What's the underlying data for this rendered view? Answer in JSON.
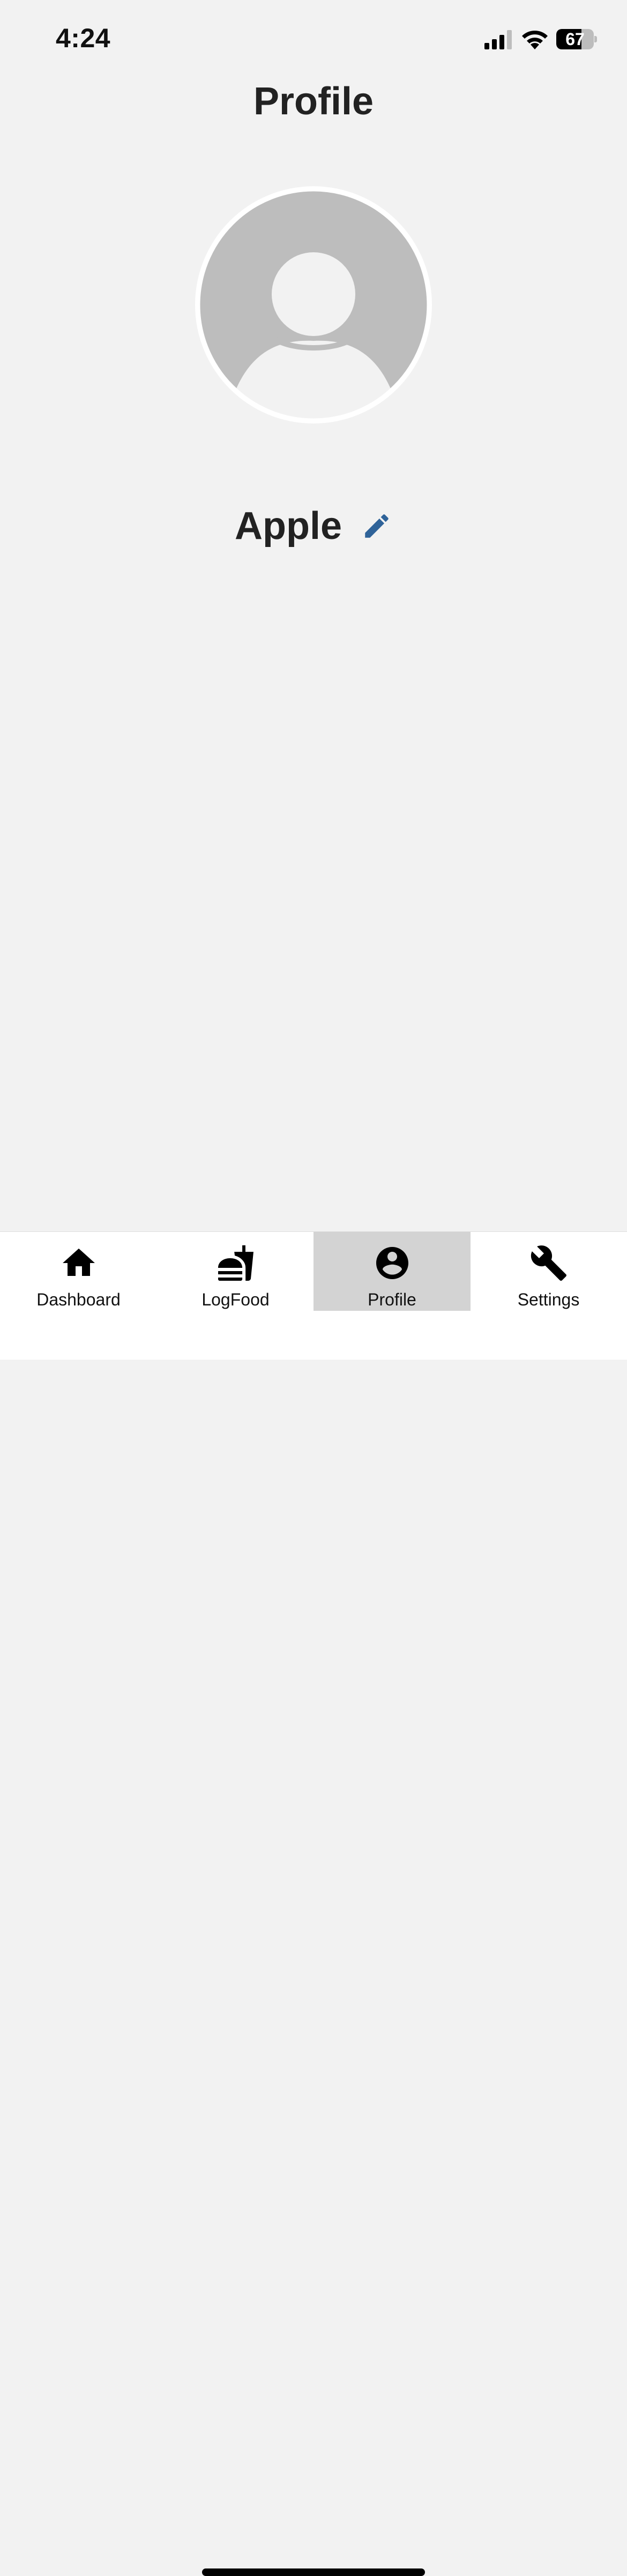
{
  "status_bar": {
    "time": "4:24",
    "battery_level": "67",
    "battery_fraction": 0.67
  },
  "page": {
    "title": "Profile"
  },
  "profile": {
    "name": "Apple",
    "avatar_icon": "default-avatar-icon",
    "edit_icon": "pencil-icon"
  },
  "colors": {
    "background": "#f2f2f2",
    "accent": "#2f6399",
    "active_tab": "#d3d3d3",
    "avatar_gray": "#bdbdbd"
  },
  "tabs": [
    {
      "label": "Dashboard",
      "icon": "home-icon",
      "active": false
    },
    {
      "label": "LogFood",
      "icon": "fastfood-icon",
      "active": false
    },
    {
      "label": "Profile",
      "icon": "account-circle-icon",
      "active": true
    },
    {
      "label": "Settings",
      "icon": "wrench-icon",
      "active": false
    }
  ]
}
